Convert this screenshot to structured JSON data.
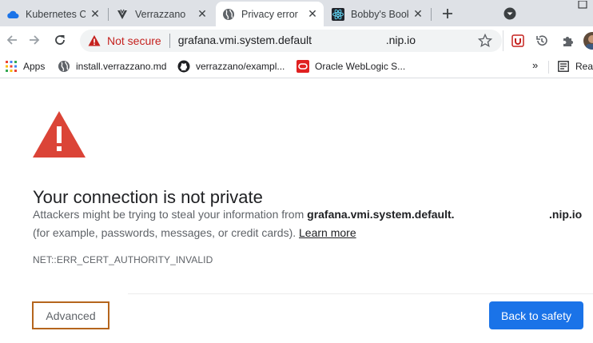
{
  "tabs": [
    {
      "title": "Kubernetes C",
      "icon": "cloud-icon",
      "active": false
    },
    {
      "title": "Verrazzano",
      "icon": "verrazzano-logo-icon",
      "active": false
    },
    {
      "title": "Privacy error",
      "icon": "globe-icon",
      "active": true
    },
    {
      "title": "Bobby's Book",
      "icon": "react-logo-icon",
      "active": false
    }
  ],
  "new_tab": "+",
  "close_glyph": "✕",
  "omnibox": {
    "security_label": "Not secure",
    "url_part1": "grafana.vmi.system.default",
    "url_part2": ".nip.io"
  },
  "bookmarks": [
    {
      "label": "Apps",
      "icon": "apps-grid-icon"
    },
    {
      "label": "install.verrazzano.md",
      "icon": "globe-icon"
    },
    {
      "label": "verrazzano/exampl...",
      "icon": "github-icon"
    },
    {
      "label": "Oracle WebLogic S...",
      "icon": "oracle-icon"
    }
  ],
  "bookmarks_overflow": "»",
  "reading_list_label": "Read",
  "page": {
    "heading": "Your connection is not private",
    "desc_prefix": "Attackers might be trying to steal your information from ",
    "host_part1": "grafana.vmi.system.default.",
    "host_part2": ".nip.io",
    "desc_line2": "(for example, passwords, messages, or credit cards). ",
    "learn_more": "Learn more",
    "error_code": "NET::ERR_CERT_AUTHORITY_INVALID",
    "advanced_button": "Advanced",
    "back_button": "Back to safety"
  },
  "colors": {
    "warning_red": "#db4437",
    "not_secure_red": "#c5221f",
    "primary_blue": "#1a73e8",
    "highlight_border": "#b5651d"
  }
}
